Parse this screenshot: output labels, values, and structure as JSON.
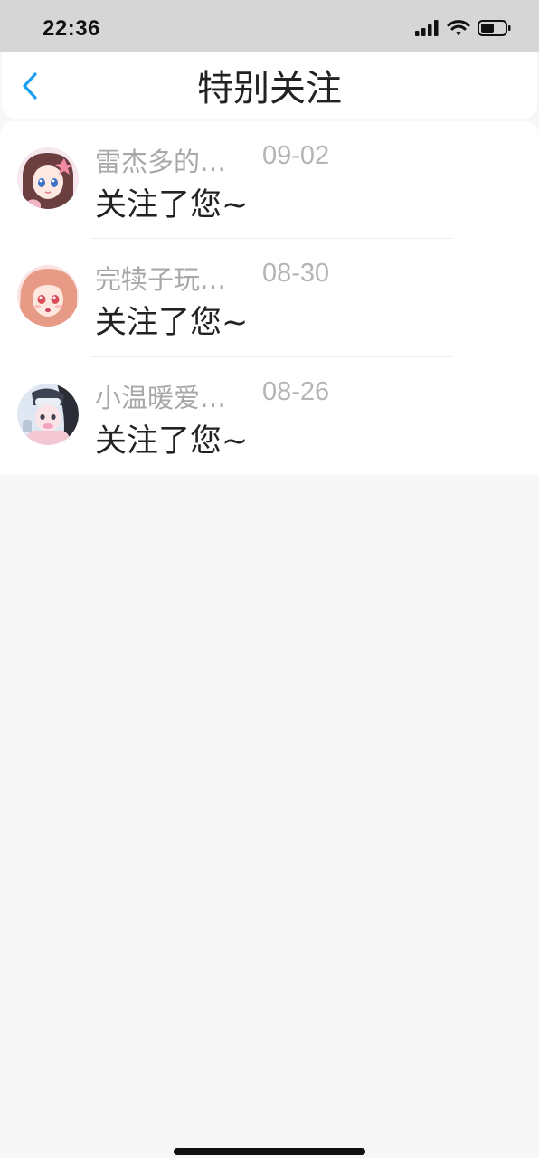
{
  "status_bar": {
    "time": "22:36",
    "icons": [
      "signal-icon",
      "wifi-icon",
      "battery-icon"
    ]
  },
  "nav": {
    "back_icon": "chevron-left-icon",
    "title": "特别关注"
  },
  "notifications": [
    {
      "name": "雷杰多的…",
      "date": "09-02",
      "message": "关注了您~",
      "avatar": "avatar-icon"
    },
    {
      "name": "完犊子玩…",
      "date": "08-30",
      "message": "关注了您~",
      "avatar": "avatar-icon"
    },
    {
      "name": "小温暖爱…",
      "date": "08-26",
      "message": "关注了您~",
      "avatar": "avatar-icon"
    }
  ],
  "colors": {
    "accent": "#1a9cf0",
    "status_bar_bg": "#d6d6d6",
    "page_bg": "#f7f7f7",
    "meta_text": "#a8a8a8",
    "primary_text": "#222222"
  }
}
